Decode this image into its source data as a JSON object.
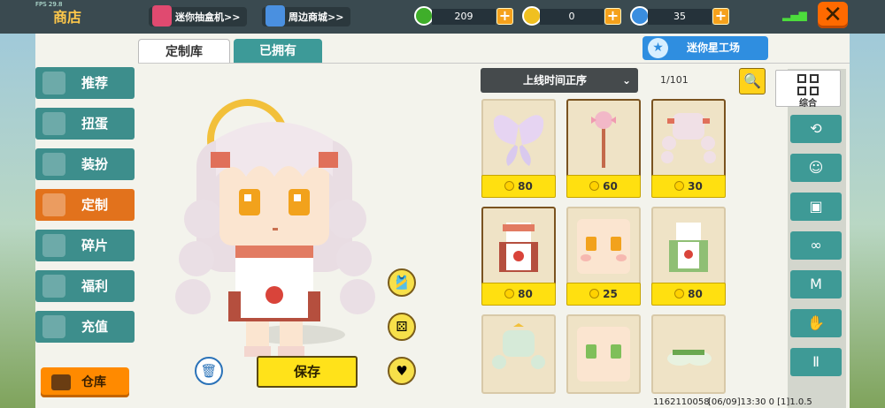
{
  "topbar": {
    "fps": "FPS 29.8",
    "title": "商店",
    "gacha_button": "迷你抽盒机>>",
    "merch_button": "周边商城>>",
    "currencies": [
      {
        "icon": "green-gem-icon",
        "value": "209",
        "color": "#3fae2a"
      },
      {
        "icon": "gold-coin-icon",
        "value": "0",
        "color": "#f0c020"
      },
      {
        "icon": "mini-coin-icon",
        "value": "35",
        "color": "#3a8ee0"
      }
    ],
    "close_icon": "close-icon"
  },
  "tabs": {
    "custom": "定制库",
    "owned": "已拥有",
    "workshop": "迷你星工场"
  },
  "nav": {
    "items": [
      {
        "label": "推荐",
        "icon": "thumbs-up-icon"
      },
      {
        "label": "扭蛋",
        "icon": "capsule-icon"
      },
      {
        "label": "装扮",
        "icon": "shirt-icon"
      },
      {
        "label": "定制",
        "icon": "pencil-icon"
      },
      {
        "label": "碎片",
        "icon": "puzzle-icon"
      },
      {
        "label": "福利",
        "icon": "gift-icon"
      },
      {
        "label": "充值",
        "icon": "coin-stack-icon"
      }
    ],
    "active": "定制",
    "storage": "仓库"
  },
  "preview": {
    "save": "保存"
  },
  "items": {
    "sort": "上线时间正序",
    "page": "1/101",
    "cards": [
      {
        "name": "butterfly-wings",
        "price": "80",
        "selected": false
      },
      {
        "name": "magic-wand",
        "price": "60",
        "selected": true
      },
      {
        "name": "pink-twin-tails-hair",
        "price": "30",
        "selected": true
      },
      {
        "name": "strawberry-dress",
        "price": "80",
        "selected": true
      },
      {
        "name": "blush-face",
        "price": "25",
        "selected": false
      },
      {
        "name": "green-dress",
        "price": "80",
        "selected": false
      },
      {
        "name": "mint-hair",
        "price": "",
        "selected": false
      },
      {
        "name": "green-eyes-face",
        "price": "",
        "selected": false
      },
      {
        "name": "green-shoes",
        "price": "",
        "selected": false
      }
    ]
  },
  "filters": {
    "all": "综合",
    "icons": [
      "history-icon",
      "face-icon",
      "head-icon",
      "mask-icon",
      "shirt-icon",
      "hand-icon",
      "pants-icon"
    ]
  },
  "footer": {
    "uid": "1162110058",
    "version": "[06/09]13:30 0 [1]1.0.5"
  }
}
